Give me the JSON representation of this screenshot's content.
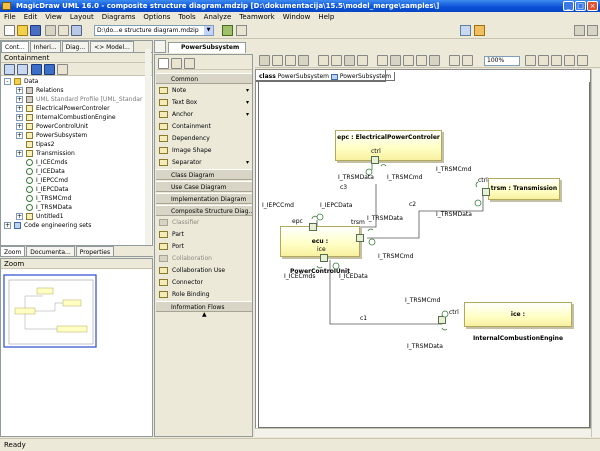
{
  "window": {
    "title": "MagicDraw UML 16.0 - composite structure diagram.mdzip [D:\\dokumentacija\\15.5\\model_merge\\samples\\]",
    "controls": [
      "_",
      "□",
      "×"
    ]
  },
  "menu": [
    "File",
    "Edit",
    "View",
    "Layout",
    "Diagrams",
    "Options",
    "Tools",
    "Analyze",
    "Teamwork",
    "Window",
    "Help"
  ],
  "toolbar": {
    "project_combo": "D:\\do...e structure diagram.mdzip",
    "zoom": "100%"
  },
  "browser": {
    "tabs": [
      "Cont...",
      "Inheri...",
      "Diag...",
      "<> Model..."
    ],
    "containment_title": "Containment",
    "tree": [
      {
        "label": "Data",
        "icon": "folder",
        "level": 0,
        "exp": "-"
      },
      {
        "label": "Relations",
        "icon": "pkg",
        "level": 1,
        "exp": "+"
      },
      {
        "label": "UML Standard Profile [UML_Standar",
        "icon": "pkg",
        "level": 1,
        "exp": "+",
        "muted": true
      },
      {
        "label": "ElectricalPowerControler",
        "icon": "cls",
        "level": 1,
        "exp": "+"
      },
      {
        "label": "InternalCombustionEngine",
        "icon": "cls",
        "level": 1,
        "exp": "+"
      },
      {
        "label": "PowerControlUnit",
        "icon": "cls",
        "level": 1,
        "exp": "+"
      },
      {
        "label": "PowerSubsystem",
        "icon": "cls",
        "level": 1,
        "exp": "+"
      },
      {
        "label": "tipas2",
        "icon": "cls",
        "level": 1,
        "exp": ""
      },
      {
        "label": "Transmission",
        "icon": "cls",
        "level": 1,
        "exp": "+"
      },
      {
        "label": "I_ICECmds",
        "icon": "itf",
        "level": 1,
        "exp": ""
      },
      {
        "label": "I_ICEData",
        "icon": "itf",
        "level": 1,
        "exp": ""
      },
      {
        "label": "I_IEPCCmd",
        "icon": "itf",
        "level": 1,
        "exp": ""
      },
      {
        "label": "I_IEPCData",
        "icon": "itf",
        "level": 1,
        "exp": ""
      },
      {
        "label": "I_TRSMCmd",
        "icon": "itf",
        "level": 1,
        "exp": ""
      },
      {
        "label": "I_TRSMData",
        "icon": "itf",
        "level": 1,
        "exp": ""
      },
      {
        "label": "Untitled1",
        "icon": "cls",
        "level": 1,
        "exp": "+"
      },
      {
        "label": "Code engineering sets",
        "icon": "diag",
        "level": 0,
        "exp": "+"
      }
    ],
    "lower_tabs": [
      "Zoom",
      "Documenta...",
      "Properties"
    ],
    "zoom_title": "Zoom"
  },
  "palette": {
    "items": [
      {
        "label": "Common",
        "kind": "group"
      },
      {
        "label": "Note",
        "kind": "item",
        "arrow": true,
        "icon": "note-icon"
      },
      {
        "label": "Text Box",
        "kind": "item",
        "arrow": true,
        "icon": "text-box-icon"
      },
      {
        "label": "Anchor",
        "kind": "item",
        "arrow": true,
        "icon": "anchor-icon"
      },
      {
        "label": "Containment",
        "kind": "item",
        "icon": "containment-icon"
      },
      {
        "label": "Dependency",
        "kind": "item",
        "icon": "dependency-icon"
      },
      {
        "label": "Image Shape",
        "kind": "item",
        "icon": "image-shape-icon"
      },
      {
        "label": "Separator",
        "kind": "item",
        "arrow": true,
        "icon": "separator-icon"
      },
      {
        "label": "Class Diagram",
        "kind": "group"
      },
      {
        "label": "Use Case Diagram",
        "kind": "group"
      },
      {
        "label": "Implementation Diagram",
        "kind": "group"
      },
      {
        "label": "Composite Structure Diag...",
        "kind": "group"
      },
      {
        "label": "Classifier",
        "kind": "item",
        "disabled": true,
        "icon": "classifier-icon"
      },
      {
        "label": "Part",
        "kind": "item",
        "icon": "part-icon"
      },
      {
        "label": "Port",
        "kind": "item",
        "icon": "port-icon"
      },
      {
        "label": "Collaboration",
        "kind": "item",
        "disabled": true,
        "icon": "collaboration-icon"
      },
      {
        "label": "Collaboration Use",
        "kind": "item",
        "icon": "collaboration-use-icon"
      },
      {
        "label": "Connector",
        "kind": "item",
        "icon": "connector-icon"
      },
      {
        "label": "Role Binding",
        "kind": "item",
        "icon": "role-binding-icon"
      },
      {
        "label": "Information Flows",
        "kind": "group"
      }
    ]
  },
  "editor": {
    "tab": "PowerSubsystem",
    "frame": {
      "keyword": "class",
      "name": "PowerSubsystem",
      "ref": "PowerSubsystem"
    }
  },
  "diagram": {
    "parts": {
      "epc": "epc : ElectricalPowerControler",
      "trsm": "trsm : Transmission",
      "ecu": "ecu : PowerControlUnit",
      "ice": "ice : InternalCombustionEngine"
    },
    "labels": {
      "epc_ctrl": "ctrl",
      "epc_trsmdata": "I_TRSMData",
      "epc_trsmcmd": "I_TRSMCmd",
      "c3": "c3",
      "ecu_iepccmd": "I_IEPCCmd",
      "ecu_iepcdata": "I_IEPCData",
      "epc_port": "epc",
      "trsm_port": "trsm",
      "ecu_trsmdata": "I_TRSMData",
      "ecu_trsmcmd": "I_TRSMCmd",
      "ice_port": "ice",
      "ecu_icecmds": "I_ICECmds",
      "ecu_icedata": "I_ICEData",
      "trsm_trsmcmd": "I_TRSMCmd",
      "trsm_ctrl": "ctrl",
      "trsm_trsmdata": "I_TRSMData",
      "c2": "c2",
      "ice_trsmcmd": "I_TRSMCmd",
      "ice_ctrl": "ctrl",
      "c1": "c1",
      "ice_trsmdata": "I_TRSMData"
    }
  },
  "status": "Ready"
}
